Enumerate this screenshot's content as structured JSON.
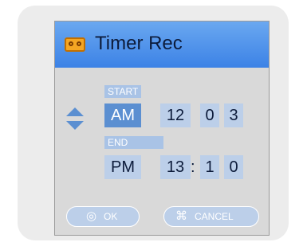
{
  "window": {
    "title": "Timer Rec",
    "icon": "vcr-tape-icon"
  },
  "start": {
    "label": "START",
    "ampm": "AM",
    "hour": "12",
    "minute_tens": "0",
    "minute_ones": "3"
  },
  "end": {
    "label": "END",
    "ampm": "PM",
    "hour": "13",
    "separator": ":",
    "minute_tens": "1",
    "minute_ones": "0"
  },
  "buttons": {
    "ok_label": "OK",
    "cancel_label": "CANCEL"
  },
  "colors": {
    "title_bar": "#3c82e6",
    "selected_cell": "#5b8fd1",
    "cell": "#bccfe9",
    "panel": "#d9d9d9"
  }
}
